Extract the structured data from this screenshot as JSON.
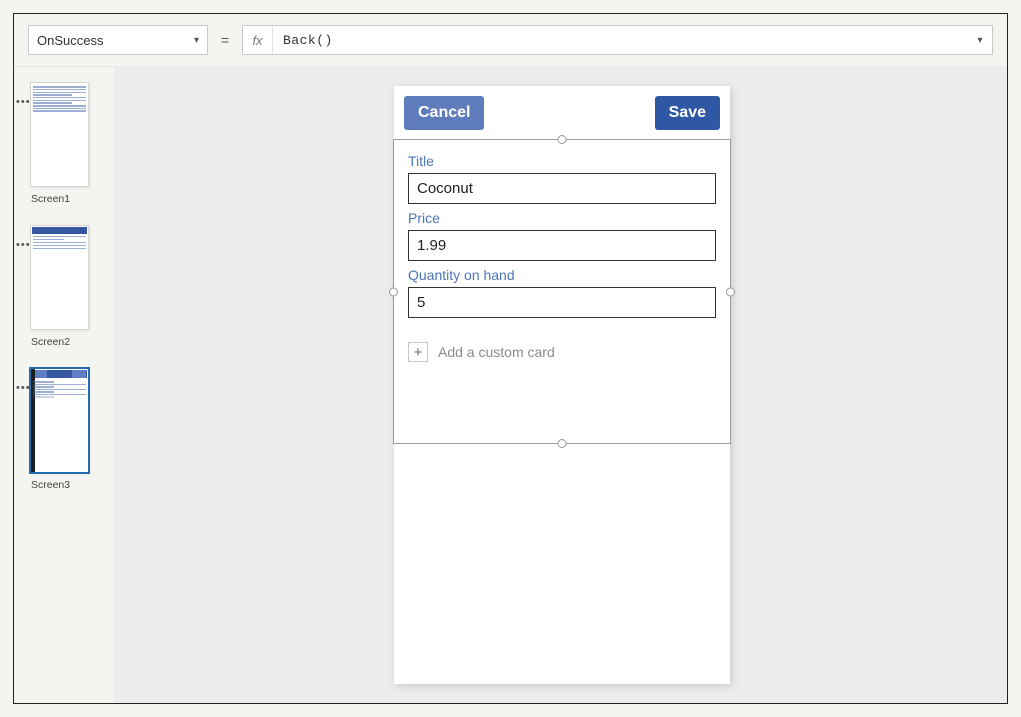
{
  "formula_bar": {
    "selected_property": "OnSuccess",
    "formula": "Back()",
    "fx_label": "fx",
    "eq_sign": "="
  },
  "thumbnails": {
    "items": [
      {
        "label": "Screen1"
      },
      {
        "label": "Screen2"
      },
      {
        "label": "Screen3"
      }
    ]
  },
  "form": {
    "header": {
      "cancel_label": "Cancel",
      "save_label": "Save"
    },
    "fields": [
      {
        "label": "Title",
        "value": "Coconut"
      },
      {
        "label": "Price",
        "value": "1.99"
      },
      {
        "label": "Quantity on hand",
        "value": "5"
      }
    ],
    "add_card_label": "Add a custom card"
  }
}
